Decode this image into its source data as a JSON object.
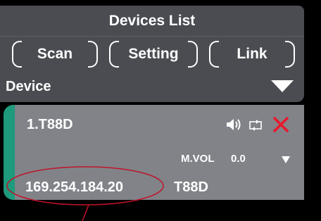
{
  "header": {
    "title": "Devices List"
  },
  "toolbar": {
    "scan_label": "Scan",
    "setting_label": "Setting",
    "link_label": "Link"
  },
  "section": {
    "label": "Device"
  },
  "device": {
    "name": "1.T88D",
    "volume_label": "M.VOL",
    "volume_value": "0.0",
    "ip": "169.254.184.20",
    "model": "T88D",
    "icons": [
      "speaker-icon",
      "loop-icon",
      "close-icon"
    ]
  },
  "colors": {
    "panel": "#4a4c52",
    "card": "#818389",
    "accent": "#1e9a7c",
    "delete": "#e8182c",
    "annotation": "#c0142a"
  }
}
